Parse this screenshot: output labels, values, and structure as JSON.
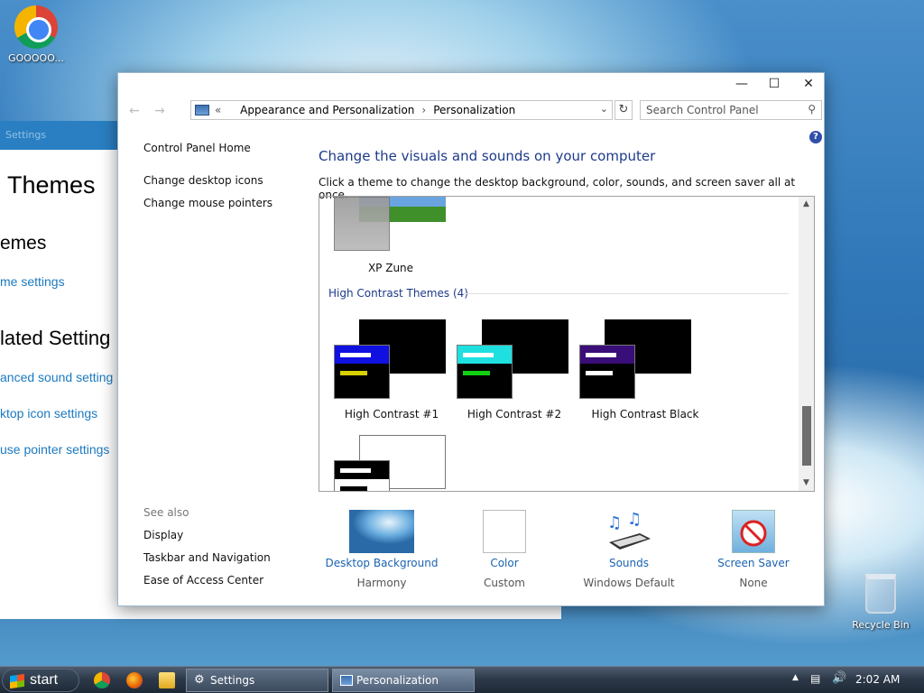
{
  "desktop": {
    "chrome_label": "GOOOOO...",
    "recycle_label": "Recycle Bin"
  },
  "settings_window": {
    "top_label": "Settings",
    "heading": "Themes",
    "subheading": "emes",
    "link_theme_settings": "me settings",
    "related_heading": "lated Setting",
    "link_sound": "anced sound setting",
    "link_desktop_icon": "ktop icon settings",
    "link_mouse": "use pointer settings"
  },
  "control_panel": {
    "breadcrumb_prefix": "«",
    "breadcrumb": [
      "Appearance and Personalization",
      "Personalization"
    ],
    "search_placeholder": "Search Control Panel",
    "left_nav": {
      "home": "Control Panel Home",
      "desktop_icons": "Change desktop icons",
      "mouse_pointers": "Change mouse pointers",
      "see_also": "See also",
      "display": "Display",
      "taskbar": "Taskbar and Navigation",
      "ease": "Ease of Access Center"
    },
    "title": "Change the visuals and sounds on your computer",
    "description": "Click a theme to change the desktop background, color, sounds, and screen saver all at once.",
    "themes": {
      "xp_zune": "XP Zune",
      "group_title": "High Contrast Themes (4)",
      "hc1": "High Contrast #1",
      "hc2": "High Contrast #2",
      "hc_black": "High Contrast Black"
    },
    "bottom": [
      {
        "link": "Desktop Background",
        "sub": "Harmony"
      },
      {
        "link": "Color",
        "sub": "Custom"
      },
      {
        "link": "Sounds",
        "sub": "Windows Default"
      },
      {
        "link": "Screen Saver",
        "sub": "None"
      }
    ]
  },
  "taskbar": {
    "start": "start",
    "tasks": [
      "Settings",
      "Personalization"
    ],
    "clock": "2:02 AM"
  }
}
